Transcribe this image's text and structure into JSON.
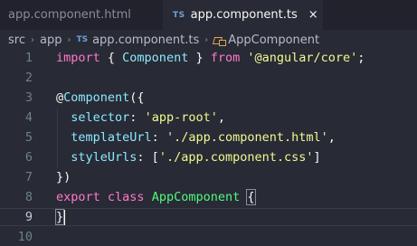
{
  "tabs": [
    {
      "label": "app.component.html",
      "badge": "",
      "active": false
    },
    {
      "label": "app.component.ts",
      "badge": "TS",
      "active": true
    }
  ],
  "close_icon": "×",
  "breadcrumb": {
    "items": [
      "src",
      "app",
      "app.component.ts",
      "AppComponent"
    ],
    "file_badge": "TS",
    "separator": "›"
  },
  "editor": {
    "line_numbers": [
      "1",
      "2",
      "3",
      "4",
      "5",
      "6",
      "7",
      "8",
      "9",
      "10"
    ],
    "current_line": 9,
    "lines": [
      [
        {
          "t": "import",
          "c": "kw"
        },
        {
          "t": " { ",
          "c": "pun"
        },
        {
          "t": "Component",
          "c": "cls"
        },
        {
          "t": " } ",
          "c": "pun"
        },
        {
          "t": "from",
          "c": "kw"
        },
        {
          "t": " ",
          "c": "pun"
        },
        {
          "t": "'@angular/core'",
          "c": "str"
        },
        {
          "t": ";",
          "c": "pun"
        }
      ],
      [],
      [
        {
          "t": "@",
          "c": "pun"
        },
        {
          "t": "Component",
          "c": "cls"
        },
        {
          "t": "({",
          "c": "pun"
        }
      ],
      [
        {
          "t": "  ",
          "c": "pun"
        },
        {
          "t": "selector",
          "c": "prop"
        },
        {
          "t": ": ",
          "c": "pun"
        },
        {
          "t": "'app-root'",
          "c": "str"
        },
        {
          "t": ",",
          "c": "pun"
        }
      ],
      [
        {
          "t": "  ",
          "c": "pun"
        },
        {
          "t": "templateUrl",
          "c": "prop"
        },
        {
          "t": ": ",
          "c": "pun"
        },
        {
          "t": "'./app.component.html'",
          "c": "str"
        },
        {
          "t": ",",
          "c": "pun"
        }
      ],
      [
        {
          "t": "  ",
          "c": "pun"
        },
        {
          "t": "styleUrls",
          "c": "prop"
        },
        {
          "t": ": [",
          "c": "pun"
        },
        {
          "t": "'./app.component.css'",
          "c": "str"
        },
        {
          "t": "]",
          "c": "pun"
        }
      ],
      [
        {
          "t": "})",
          "c": "pun"
        }
      ],
      [
        {
          "t": "export",
          "c": "kw"
        },
        {
          "t": " ",
          "c": "pun"
        },
        {
          "t": "class",
          "c": "kw"
        },
        {
          "t": " ",
          "c": "pun"
        },
        {
          "t": "AppComponent",
          "c": "fn"
        },
        {
          "t": " ",
          "c": "pun"
        },
        {
          "t": "{",
          "c": "pun brace-match"
        }
      ],
      [
        {
          "t": "}",
          "c": "pun brace-match"
        }
      ],
      []
    ]
  },
  "colors": {
    "background": "#282a36",
    "tab_bar": "#21222c",
    "keyword": "#ff79c6",
    "class": "#8be9fd",
    "string": "#f1fa8c",
    "function": "#50fa7b"
  }
}
